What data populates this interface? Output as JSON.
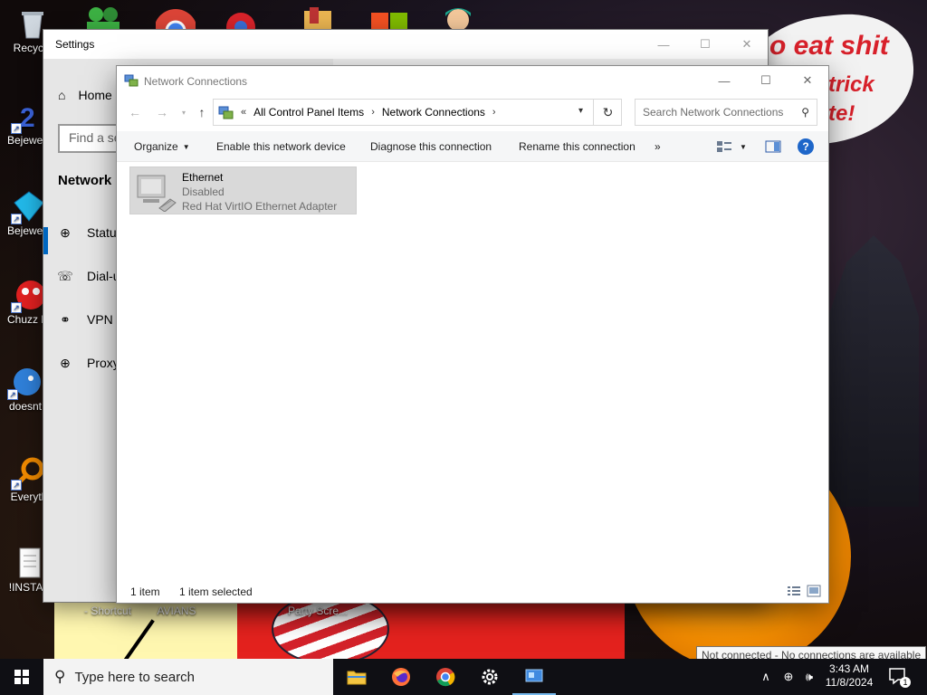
{
  "desktop": {
    "wallpaper_text": [
      "o eat shit",
      "trick",
      "te!"
    ],
    "icons": [
      {
        "label": "Recycle",
        "icon": "recycle-bin-icon"
      },
      {
        "label": "Bejewel Delux",
        "icon": "bejeweled-icon"
      },
      {
        "label": "Bejewel Delux",
        "icon": "bejeweled-gem-icon"
      },
      {
        "label": "Chuzz Delux",
        "icon": "chuzzle-icon"
      },
      {
        "label": "doesnt",
        "icon": "bird-icon"
      },
      {
        "label": "Everyth",
        "icon": "everything-search-icon"
      },
      {
        "label": "!INSTAL",
        "icon": "text-document-icon"
      }
    ],
    "bottom_labels": [
      "- Shortcut",
      "AVIANS",
      "Party Scre..."
    ]
  },
  "settings": {
    "title": "Settings",
    "home": "Home",
    "find_placeholder": "Find a se",
    "section": "Network &",
    "nav": [
      {
        "label": "Status",
        "icon": "globe-status-icon"
      },
      {
        "label": "Dial-u",
        "icon": "dialup-icon"
      },
      {
        "label": "VPN",
        "icon": "vpn-icon"
      },
      {
        "label": "Proxy",
        "icon": "proxy-globe-icon"
      }
    ]
  },
  "network_connections": {
    "title": "Network Connections",
    "breadcrumb": [
      "All Control Panel Items",
      "Network Connections"
    ],
    "breadcrumb_prefix": "«",
    "search_placeholder": "Search Network Connections",
    "toolbar": {
      "organize": "Organize",
      "enable": "Enable this network device",
      "diagnose": "Diagnose this connection",
      "rename": "Rename this connection",
      "more": "»"
    },
    "items": [
      {
        "name": "Ethernet",
        "status": "Disabled",
        "device": "Red Hat VirtIO Ethernet Adapter"
      }
    ],
    "status_bar": {
      "count": "1 item",
      "selected": "1 item selected"
    }
  },
  "taskbar": {
    "search_placeholder": "Type here to search",
    "time": "3:43 AM",
    "date": "11/8/2024",
    "notification_count": "1",
    "network_tooltip": "Not connected - No connections are available",
    "pinned_apps": [
      "file-explorer-icon",
      "firefox-icon",
      "chrome-icon",
      "settings-gear-icon",
      "control-panel-icon"
    ]
  },
  "colors": {
    "accent": "#0067c0",
    "selection": "#d9d9d9",
    "taskbar": "#0f0f14",
    "help": "#1e66c9"
  }
}
